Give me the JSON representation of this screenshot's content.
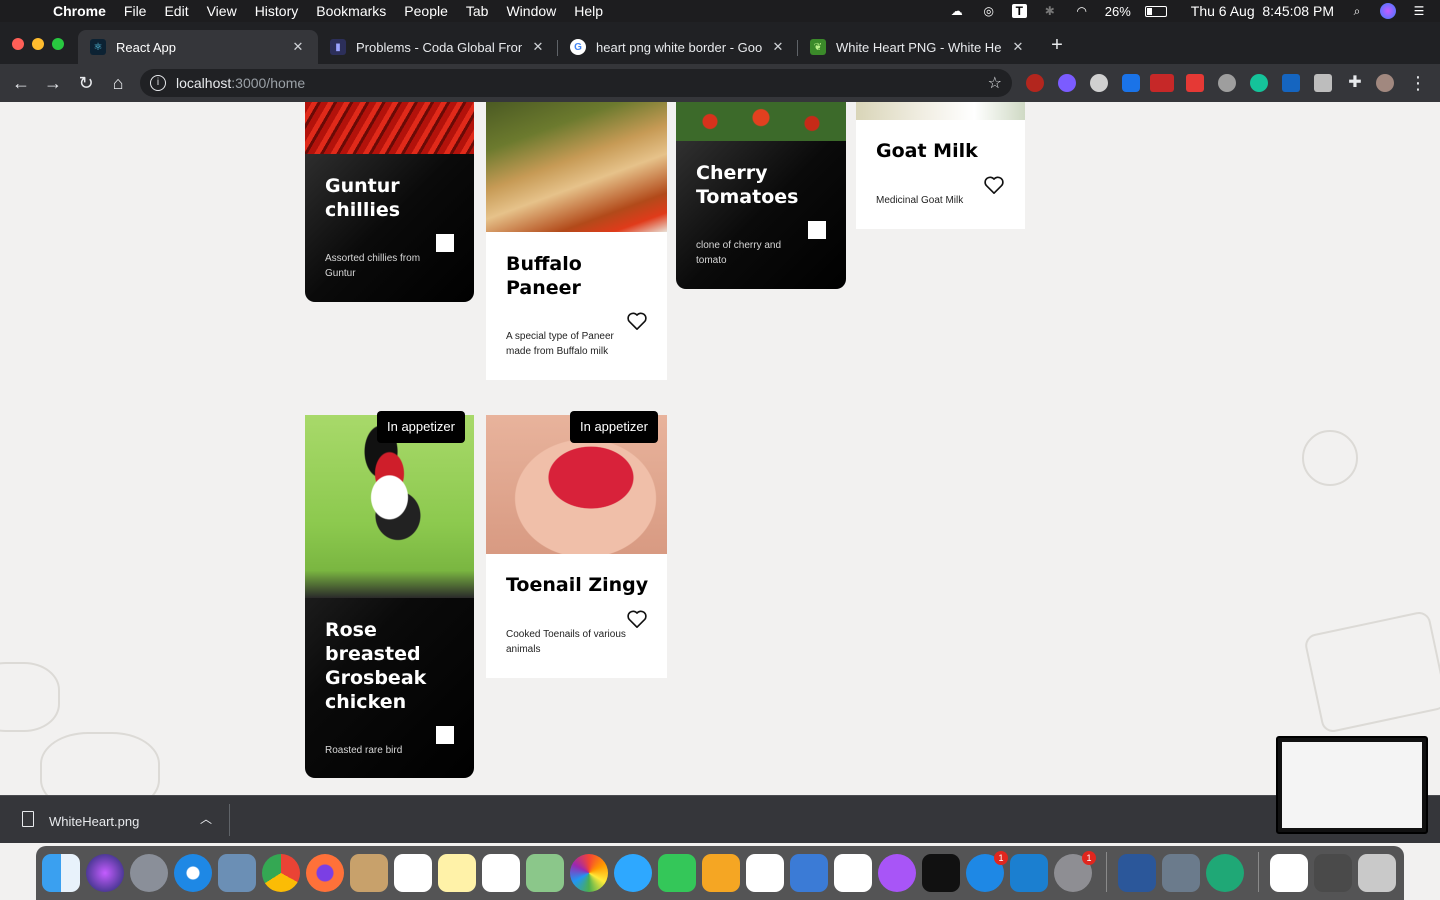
{
  "menubar": {
    "app": "Chrome",
    "items": [
      "File",
      "Edit",
      "View",
      "History",
      "Bookmarks",
      "People",
      "Tab",
      "Window",
      "Help"
    ],
    "battery": "26%",
    "clock": "Thu 6 Aug  8:45:08 PM"
  },
  "tabs": [
    {
      "title": "React App",
      "favicon": "react-icon",
      "active": true
    },
    {
      "title": "Problems - Coda Global Fronte",
      "favicon": "coda-icon",
      "active": false
    },
    {
      "title": "heart png white border - Googl",
      "favicon": "google-icon",
      "active": false
    },
    {
      "title": "White Heart PNG - White Heart",
      "favicon": "leaf-icon",
      "active": false
    }
  ],
  "address": {
    "host": "localhost",
    "path": ":3000/home"
  },
  "cards": {
    "guntur": {
      "title": "Guntur chillies",
      "desc": "Assorted chillies from Guntur"
    },
    "paneer": {
      "title": "Buffalo Paneer",
      "desc": "A special type of Paneer made from Buffalo milk"
    },
    "cherry": {
      "title": "Cherry Tomatoes",
      "desc": "clone of cherry and tomato"
    },
    "goat": {
      "title": "Goat Milk",
      "desc": "Medicinal Goat Milk"
    },
    "grosbeak": {
      "title": "Rose breasted Grosbeak chicken",
      "desc": "Roasted rare bird",
      "badge": "In appetizer"
    },
    "toenail": {
      "title": "Toenail Zingy",
      "desc": "Cooked Toenails of various animals",
      "badge": "In appetizer"
    }
  },
  "download": {
    "filename": "WhiteHeart.png"
  },
  "colors": {
    "chrome_dark": "#202124",
    "toolbar": "#35363a",
    "page_bg": "#f2f1f0"
  }
}
